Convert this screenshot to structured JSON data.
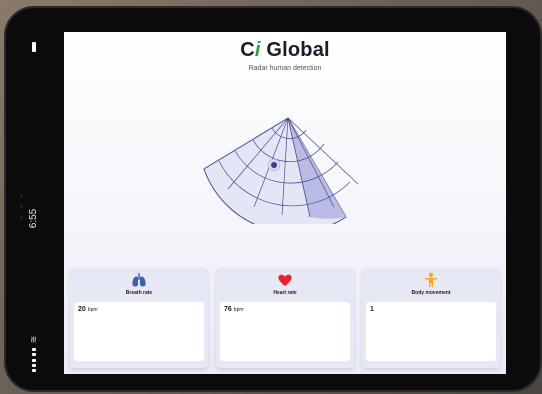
{
  "status_bar": {
    "time": "6:55",
    "wifi_icon": "wifi-icon",
    "battery_icon": "battery-icon",
    "signal_icon": "signal-icon"
  },
  "header": {
    "brand_prefix": "C",
    "brand_i": "i",
    "brand_suffix": " Global",
    "subtitle": "Radar human detection"
  },
  "radar": {
    "icon": "radar-sector-icon",
    "highlight_color": "#b9bbe3",
    "base_color": "#e4e5f5",
    "line_color": "#4a4d8f",
    "target_color": "#3b3d8a"
  },
  "cards": [
    {
      "title": "Breath rate",
      "icon": "lungs-icon",
      "value": "20",
      "unit": "bpm",
      "color": "#3f5fb0"
    },
    {
      "title": "Heart rate",
      "icon": "heart-icon",
      "value": "76",
      "unit": "bpm",
      "color": "#e8232a"
    },
    {
      "title": "Body movement",
      "icon": "person-icon",
      "value": "1",
      "unit": "",
      "color": "#f2a623"
    }
  ]
}
